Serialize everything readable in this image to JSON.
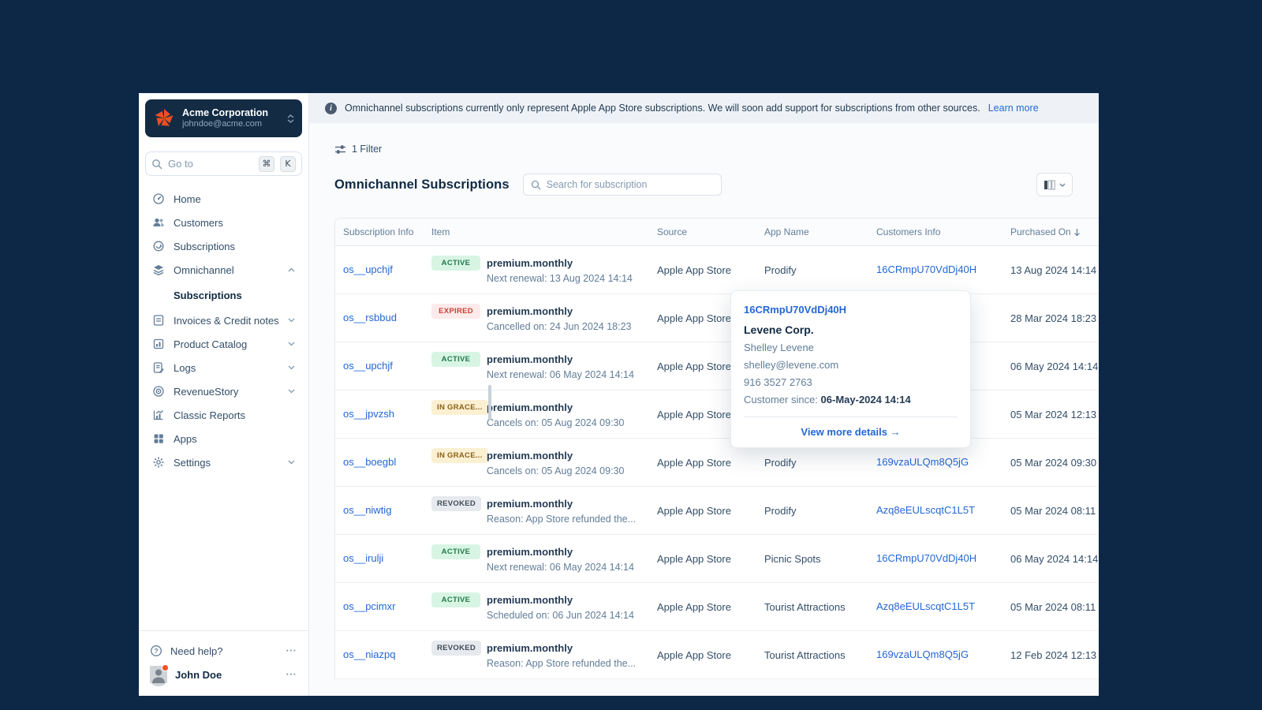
{
  "colors": {
    "page_bg": "#0d2847",
    "org_header_bg": "#132c44",
    "brand_orange": "#f04e23",
    "link_blue": "#2467d6",
    "badge_active_bg": "#d8f5e3",
    "badge_active_text": "#1f7a4d",
    "badge_expired_bg": "#fdeaea",
    "badge_expired_text": "#cf3d36",
    "badge_grace_bg": "#fbf0d2",
    "badge_grace_text": "#8a6116",
    "badge_revoked_bg": "#e6e9ed",
    "badge_revoked_text": "#3e4c59"
  },
  "icons": {
    "more": "⋯",
    "cmd": "⌘",
    "arrow_right": "→"
  },
  "sidebar": {
    "org": {
      "name": "Acme Corporation",
      "email": "johndoe@acme.com"
    },
    "search": {
      "placeholder": "Go to",
      "shortcut_mod": "⌘",
      "shortcut_key": "K"
    },
    "items": [
      {
        "label": "Home",
        "icon": "gauge",
        "chevron": "none",
        "type": "item"
      },
      {
        "label": "Customers",
        "icon": "users",
        "chevron": "none",
        "type": "item"
      },
      {
        "label": "Subscriptions",
        "icon": "subscriptions",
        "chevron": "none",
        "type": "item"
      },
      {
        "label": "Omnichannel",
        "icon": "layers",
        "chevron": "up",
        "type": "item"
      },
      {
        "label": "Subscriptions",
        "icon": "",
        "chevron": "none",
        "type": "subitem",
        "active": true
      },
      {
        "label": "Invoices & Credit notes",
        "icon": "invoice",
        "chevron": "down",
        "type": "item"
      },
      {
        "label": "Product Catalog",
        "icon": "catalog",
        "chevron": "down",
        "type": "item"
      },
      {
        "label": "Logs",
        "icon": "logs",
        "chevron": "down",
        "type": "item"
      },
      {
        "label": "RevenueStory",
        "icon": "revenuestory",
        "chevron": "down",
        "type": "item"
      },
      {
        "label": "Classic Reports",
        "icon": "reports",
        "chevron": "none",
        "type": "item"
      },
      {
        "label": "Apps",
        "icon": "apps",
        "chevron": "none",
        "type": "item"
      },
      {
        "label": "Settings",
        "icon": "settings",
        "chevron": "down",
        "type": "item"
      }
    ],
    "footer": {
      "help_label": "Need help?",
      "user_name": "John Doe"
    }
  },
  "banner": {
    "text": "Omnichannel subscriptions currently only represent Apple App Store subscriptions. We will soon add support for subscriptions from other sources.",
    "link": "Learn more"
  },
  "toolbar": {
    "filter_label": "1 Filter",
    "title": "Omnichannel Subscriptions",
    "search_placeholder": "Search for subscription"
  },
  "table": {
    "columns": [
      "Subscription Info",
      "Item",
      "Source",
      "App Name",
      "Customers Info",
      "Purchased On"
    ],
    "rows": [
      {
        "id": "os__upchjf",
        "status": "ACTIVE",
        "status_type": "active",
        "item": "premium.monthly",
        "item_sub": "Next renewal: 13 Aug 2024 14:14",
        "source": "Apple App Store",
        "app": "Prodify",
        "customer": "16CRmpU70VdDj40H",
        "purchased": "13 Aug 2024 14:14"
      },
      {
        "id": "os__rsbbud",
        "status": "EXPIRED",
        "status_type": "expired",
        "item": "premium.monthly",
        "item_sub": "Cancelled on: 24 Jun 2024 18:23",
        "source": "Apple App Store",
        "app": "",
        "customer": "",
        "purchased": "28 Mar 2024 18:23"
      },
      {
        "id": "os__upchjf",
        "status": "ACTIVE",
        "status_type": "active",
        "item": "premium.monthly",
        "item_sub": "Next renewal: 06 May 2024 14:14",
        "source": "Apple App Store",
        "app": "",
        "customer": "",
        "purchased": "06 May 2024 14:14"
      },
      {
        "id": "os__jpvzsh",
        "status": "IN GRACE...",
        "status_type": "grace",
        "item": "premium.monthly",
        "item_sub": "Cancels on: 05 Aug 2024 09:30",
        "source": "Apple App Store",
        "app": "",
        "customer": "",
        "purchased": "05 Mar 2024 12:13"
      },
      {
        "id": "os__boegbl",
        "status": "IN GRACE...",
        "status_type": "grace",
        "item": "premium.monthly",
        "item_sub": "Cancels on: 05 Aug 2024 09:30",
        "source": "Apple App Store",
        "app": "Prodify",
        "customer": "169vzaULQm8Q5jG",
        "purchased": "05 Mar 2024 09:30"
      },
      {
        "id": "os__niwtig",
        "status": "REVOKED",
        "status_type": "revoked",
        "item": "premium.monthly",
        "item_sub": "Reason: App Store refunded the...",
        "source": "Apple App Store",
        "app": "Prodify",
        "customer": "Azq8eEULscqtC1L5T",
        "purchased": "05 Mar 2024 08:11"
      },
      {
        "id": "os__irulji",
        "status": "ACTIVE",
        "status_type": "active",
        "item": "premium.monthly",
        "item_sub": "Next renewal: 06 May 2024 14:14",
        "source": "Apple App Store",
        "app": "Picnic Spots",
        "customer": "16CRmpU70VdDj40H",
        "purchased": "06 May 2024 14:14"
      },
      {
        "id": "os__pcimxr",
        "status": "ACTIVE",
        "status_type": "active",
        "item": "premium.monthly",
        "item_sub": "Scheduled on: 06 Jun 2024 14:14",
        "source": "Apple App Store",
        "app": "Tourist Attractions",
        "customer": "Azq8eEULscqtC1L5T",
        "purchased": "05 Mar 2024 08:11"
      },
      {
        "id": "os__niazpq",
        "status": "REVOKED",
        "status_type": "revoked",
        "item": "premium.monthly",
        "item_sub": "Reason: App Store refunded the...",
        "source": "Apple App Store",
        "app": "Tourist Attractions",
        "customer": "169vzaULQm8Q5jG",
        "purchased": "12 Feb 2024 12:13"
      }
    ]
  },
  "popover": {
    "customer_id": "16CRmpU70VdDj40H",
    "company": "Levene Corp.",
    "contact": "Shelley Levene",
    "email": "shelley@levene.com",
    "phone": "916 3527 2763",
    "since_label": "Customer since: ",
    "since_value": "06-May-2024 14:14",
    "cta": "View more details",
    "cta_arrow": "→"
  }
}
